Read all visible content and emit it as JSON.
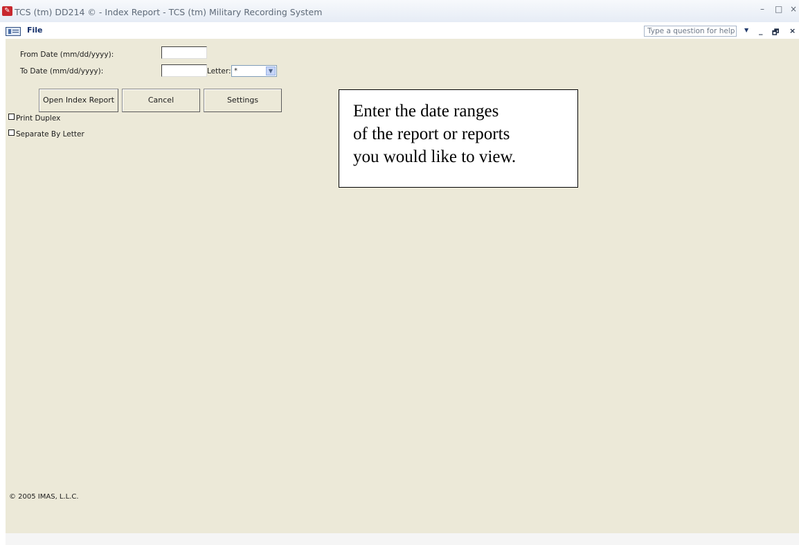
{
  "window": {
    "title": "TCS (tm) DD214 © - Index Report - TCS (tm) Military Recording System",
    "icon": "app-icon",
    "controls": {
      "minimize": "–",
      "maximize": "□",
      "close": "×"
    }
  },
  "menu": {
    "file_label": "File",
    "help_placeholder": "Type a question for help",
    "mdi_controls": {
      "minimize": "_",
      "restore": "🗗",
      "close": "×"
    }
  },
  "form": {
    "from_date_label": "From Date (mm/dd/yyyy):",
    "from_date_value": "",
    "to_date_label": "To Date (mm/dd/yyyy):",
    "to_date_value": "",
    "letter_label": "Letter:",
    "letter_value": "*",
    "buttons": {
      "open_index_report": "Open Index Report",
      "cancel": "Cancel",
      "settings": "Settings"
    },
    "checkboxes": {
      "print_duplex": "Print Duplex",
      "separate_by_letter": "Separate By Letter"
    },
    "copyright": "© 2005 IMAS, L.L.C."
  },
  "callout": {
    "lines": [
      "Enter the date ranges",
      "of the report or reports",
      "you would like to view."
    ]
  }
}
